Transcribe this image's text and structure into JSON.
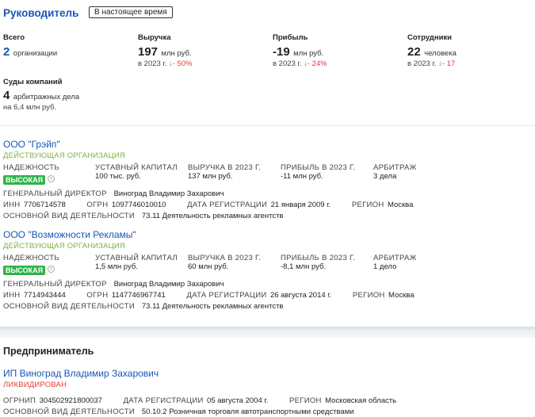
{
  "manager": {
    "title": "Руководитель",
    "period_button": "В настоящее время",
    "stats": {
      "total": {
        "label": "Всего",
        "value": "2",
        "unit": "организации"
      },
      "revenue": {
        "label": "Выручка",
        "value": "197",
        "unit": "млн руб.",
        "year": "в 2023 г.",
        "arrow": "↓",
        "delta": "- 50%"
      },
      "profit": {
        "label": "Прибыль",
        "value": "-19",
        "unit": "млн руб.",
        "year": "в 2023 г.",
        "arrow": "↓",
        "delta": "- 24%"
      },
      "employees": {
        "label": "Сотрудники",
        "value": "22",
        "unit": "человека",
        "year": "в 2023 г.",
        "arrow": "↓",
        "delta": "- 17"
      },
      "courts": {
        "label": "Суды компаний",
        "value": "4",
        "unit": "арбитражных дела",
        "sub": "на 6,4 млн руб."
      }
    },
    "companies": [
      {
        "name": "ООО \"Грэйп\"",
        "status": "ДЕЙСТВУЮЩАЯ ОРГАНИЗАЦИЯ",
        "reliability_label": "НАДЕЖНОСТЬ",
        "reliability_value": "ВЫСОКАЯ",
        "capital_label": "УСТАВНЫЙ КАПИТАЛ",
        "capital_value": "100 тыс. руб.",
        "revenue_label": "ВЫРУЧКА В 2023 Г.",
        "revenue_value": "137 млн руб.",
        "profit_label": "ПРИБЫЛЬ В 2023 Г.",
        "profit_value": "-11 млн руб.",
        "arb_label": "АРБИТРАЖ",
        "arb_value": "3 дела",
        "director_label": "ГЕНЕРАЛЬНЫЙ ДИРЕКТОР",
        "director_value": "Виноград Владимир Захарович",
        "inn_label": "ИНН",
        "inn_value": "7706714578",
        "ogrn_label": "ОГРН",
        "ogrn_value": "1097746010010",
        "reg_label": "ДАТА РЕГИСТРАЦИИ",
        "reg_value": "21 января 2009 г.",
        "region_label": "РЕГИОН",
        "region_value": "Москва",
        "activity_label": "ОСНОВНОЙ ВИД ДЕЯТЕЛЬНОСТИ",
        "activity_value": "73.11 Деятельность рекламных агентств"
      },
      {
        "name": "ООО \"Возможности Рекламы\"",
        "status": "ДЕЙСТВУЮЩАЯ ОРГАНИЗАЦИЯ",
        "reliability_label": "НАДЕЖНОСТЬ",
        "reliability_value": "ВЫСОКАЯ",
        "capital_label": "УСТАВНЫЙ КАПИТАЛ",
        "capital_value": "1,5 млн руб.",
        "revenue_label": "ВЫРУЧКА В 2023 Г.",
        "revenue_value": "60 млн руб.",
        "profit_label": "ПРИБЫЛЬ В 2023 Г.",
        "profit_value": "-8,1 млн руб.",
        "arb_label": "АРБИТРАЖ",
        "arb_value": "1 дело",
        "director_label": "ГЕНЕРАЛЬНЫЙ ДИРЕКТОР",
        "director_value": "Виноград Владимир Захарович",
        "inn_label": "ИНН",
        "inn_value": "7714943444",
        "ogrn_label": "ОГРН",
        "ogrn_value": "1147746967741",
        "reg_label": "ДАТА РЕГИСТРАЦИИ",
        "reg_value": "26 августа 2014 г.",
        "region_label": "РЕГИОН",
        "region_value": "Москва",
        "activity_label": "ОСНОВНОЙ ВИД ДЕЯТЕЛЬНОСТИ",
        "activity_value": "73.11 Деятельность рекламных агентств"
      }
    ]
  },
  "entrepreneur": {
    "title": "Предприниматель",
    "name": "ИП Виноград Владимир Захарович",
    "status": "ЛИКВИДИРОВАН",
    "ogrnip_label": "ОГРНИП",
    "ogrnip_value": "304502921800037",
    "reg_label": "ДАТА РЕГИСТРАЦИИ",
    "reg_value": "05 августа 2004 г.",
    "region_label": "РЕГИОН",
    "region_value": "Московская область",
    "activity_label": "ОСНОВНОЙ ВИД ДЕЯТЕЛЬНОСТИ",
    "activity_value": "50.10.2 Розничная торговля автотранспортными средствами"
  },
  "icons": {
    "info": "info-icon",
    "down_arrow": "arrow-down-icon"
  },
  "colors": {
    "link": "#1a56b5",
    "active_status": "#7cb342",
    "badge_high": "#2fb34a",
    "negative": "#e53935"
  }
}
